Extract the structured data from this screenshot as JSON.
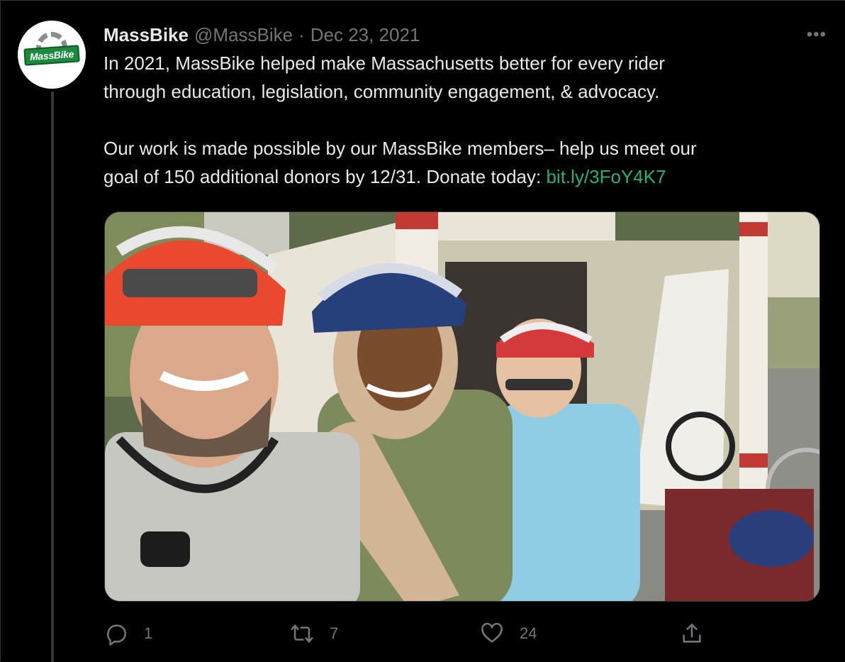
{
  "tweet": {
    "display_name": "MassBike",
    "handle": "@MassBike",
    "separator": "·",
    "date": "Dec 23, 2021",
    "more_label": "•••",
    "avatar_logo_text": "MassBike",
    "text_part1": "In 2021, MassBike helped make Massachusetts better for every rider\nthrough education, legislation, community engagement, & advocacy.\n\nOur work is made possible by our MassBike members– help us meet our\ngoal of 150 additional donors by 12/31. Donate today: ",
    "link_text": "bit.ly/3FoY4K7"
  },
  "actions": {
    "reply_count": "1",
    "retweet_count": "7",
    "like_count": "24"
  },
  "colors": {
    "background": "#000000",
    "text": "#e7e9ea",
    "muted": "#71767b",
    "link": "#22b27d"
  },
  "icons": {
    "reply": "reply-icon",
    "retweet": "retweet-icon",
    "like": "heart-icon",
    "share": "share-icon",
    "more": "more-icon"
  }
}
